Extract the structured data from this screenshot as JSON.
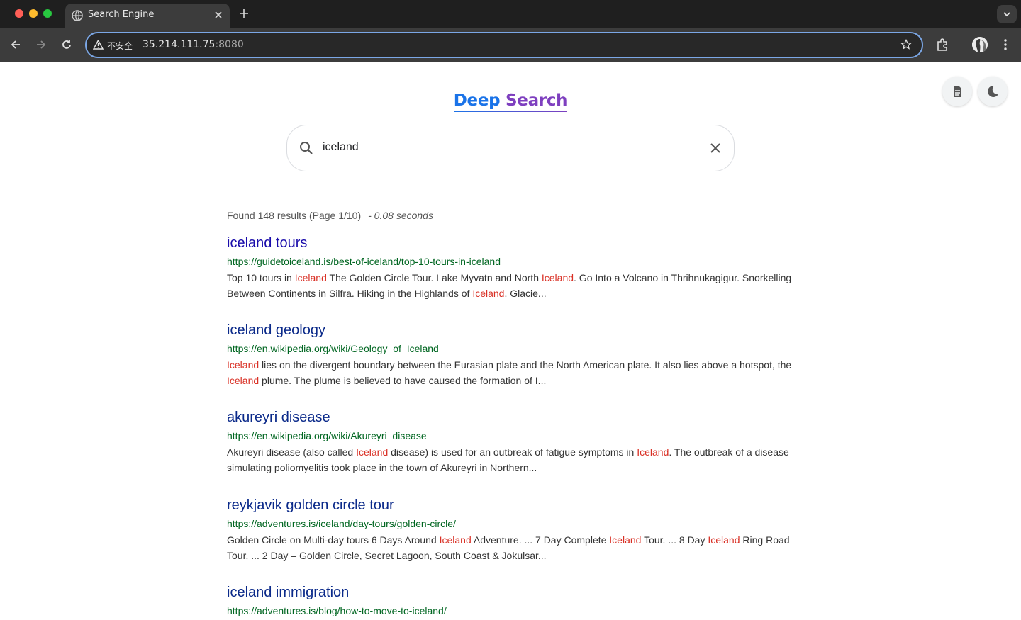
{
  "browser": {
    "tab_title": "Search Engine",
    "omnibox": {
      "insecure_label": "不安全",
      "host": "35.214.111.75",
      "port": ":8080"
    },
    "icons": [
      "globe-icon",
      "close-icon",
      "plus-icon",
      "chevron-down-icon",
      "back-icon",
      "forward-icon",
      "reload-icon",
      "warning-icon",
      "star-icon",
      "extensions-icon",
      "avatar",
      "more-icon"
    ]
  },
  "page": {
    "logo_word1": "Deep",
    "logo_word2": "Search",
    "search": {
      "value": "iceland",
      "placeholder": ""
    },
    "stats": {
      "found": "Found 148 results (Page 1/10)",
      "time": "- 0.08 seconds"
    },
    "results": [
      {
        "title": "iceland tours",
        "url": "https://guidetoiceland.is/best-of-iceland/top-10-tours-in-iceland",
        "snippet": [
          {
            "t": "Top 10 tours in "
          },
          {
            "t": "Iceland",
            "hl": true
          },
          {
            "t": " The Golden Circle Tour. Lake Myvatn and North "
          },
          {
            "t": "Iceland",
            "hl": true
          },
          {
            "t": ". Go Into a Volcano in Thrihnukagigur. Snorkelling Between Continents in Silfra. Hiking in the Highlands of "
          },
          {
            "t": "Iceland",
            "hl": true
          },
          {
            "t": ". Glacie..."
          }
        ]
      },
      {
        "title": "iceland geology",
        "url": "https://en.wikipedia.org/wiki/Geology_of_Iceland",
        "snippet": [
          {
            "t": "Iceland",
            "hl": true
          },
          {
            "t": " lies on the divergent boundary between the Eurasian plate and the North American plate. It also lies above a hotspot, the "
          },
          {
            "t": "Iceland",
            "hl": true
          },
          {
            "t": " plume. The plume is believed to have caused the formation of I..."
          }
        ]
      },
      {
        "title": "akureyri disease",
        "url": "https://en.wikipedia.org/wiki/Akureyri_disease",
        "snippet": [
          {
            "t": "Akureyri disease (also called "
          },
          {
            "t": "Iceland",
            "hl": true
          },
          {
            "t": " disease) is used for an outbreak of fatigue symptoms in "
          },
          {
            "t": "Iceland",
            "hl": true
          },
          {
            "t": ". The outbreak of a disease simulating poliomyelitis took place in the town of Akureyri in Northern..."
          }
        ]
      },
      {
        "title": "reykjavik golden circle tour",
        "url": "https://adventures.is/iceland/day-tours/golden-circle/",
        "snippet": [
          {
            "t": "Golden Circle on Multi-day tours 6 Days Around "
          },
          {
            "t": "Iceland",
            "hl": true
          },
          {
            "t": " Adventure. ... 7 Day Complete "
          },
          {
            "t": "Iceland",
            "hl": true
          },
          {
            "t": " Tour. ... 8 Day "
          },
          {
            "t": "Iceland",
            "hl": true
          },
          {
            "t": " Ring Road Tour. ... 2 Day – Golden Circle, Secret Lagoon, South Coast & Jokulsar..."
          }
        ]
      },
      {
        "title": "iceland immigration",
        "url": "https://adventures.is/blog/how-to-move-to-iceland/",
        "snippet": []
      }
    ],
    "colors": {
      "title": "#1a0dab",
      "url": "#006621",
      "highlight": "#d93025",
      "logo_blue": "#1a73e8",
      "logo_purple": "#7e3fbf"
    }
  }
}
